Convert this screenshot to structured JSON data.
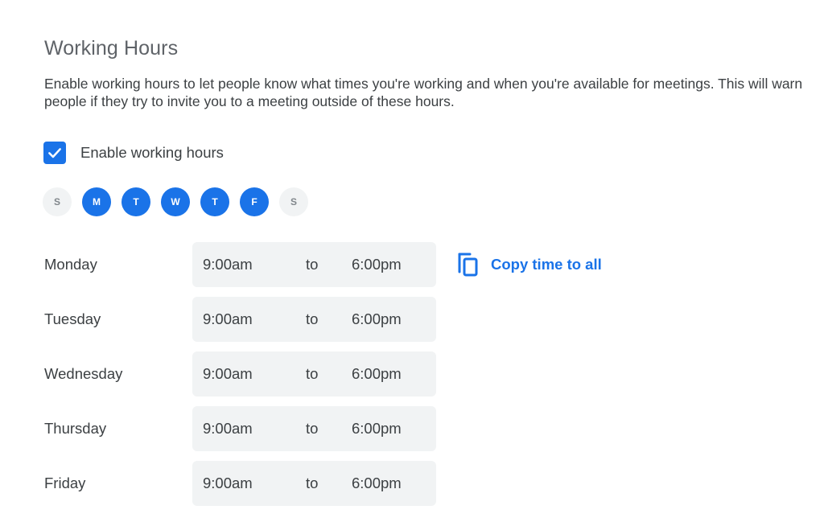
{
  "section": {
    "title": "Working Hours",
    "description": "Enable working hours to let people know what times you're working and when you're available for meetings. This will warn people if they try to invite you to a meeting outside of these hours."
  },
  "enable": {
    "label": "Enable working hours",
    "checked": true
  },
  "day_toggles": [
    {
      "letter": "S",
      "day": "Sunday",
      "selected": false
    },
    {
      "letter": "M",
      "day": "Monday",
      "selected": true
    },
    {
      "letter": "T",
      "day": "Tuesday",
      "selected": true
    },
    {
      "letter": "W",
      "day": "Wednesday",
      "selected": true
    },
    {
      "letter": "T",
      "day": "Thursday",
      "selected": true
    },
    {
      "letter": "F",
      "day": "Friday",
      "selected": true
    },
    {
      "letter": "S",
      "day": "Saturday",
      "selected": false
    }
  ],
  "schedule": [
    {
      "day": "Monday",
      "start": "9:00am",
      "separator": "to",
      "end": "6:00pm"
    },
    {
      "day": "Tuesday",
      "start": "9:00am",
      "separator": "to",
      "end": "6:00pm"
    },
    {
      "day": "Wednesday",
      "start": "9:00am",
      "separator": "to",
      "end": "6:00pm"
    },
    {
      "day": "Thursday",
      "start": "9:00am",
      "separator": "to",
      "end": "6:00pm"
    },
    {
      "day": "Friday",
      "start": "9:00am",
      "separator": "to",
      "end": "6:00pm"
    }
  ],
  "copy_action": {
    "label": "Copy time to all",
    "icon": "copy-icon"
  },
  "colors": {
    "accent": "#1a73e8",
    "field_bg": "#f1f3f4",
    "text": "#3c4043",
    "muted": "#5f6368"
  }
}
